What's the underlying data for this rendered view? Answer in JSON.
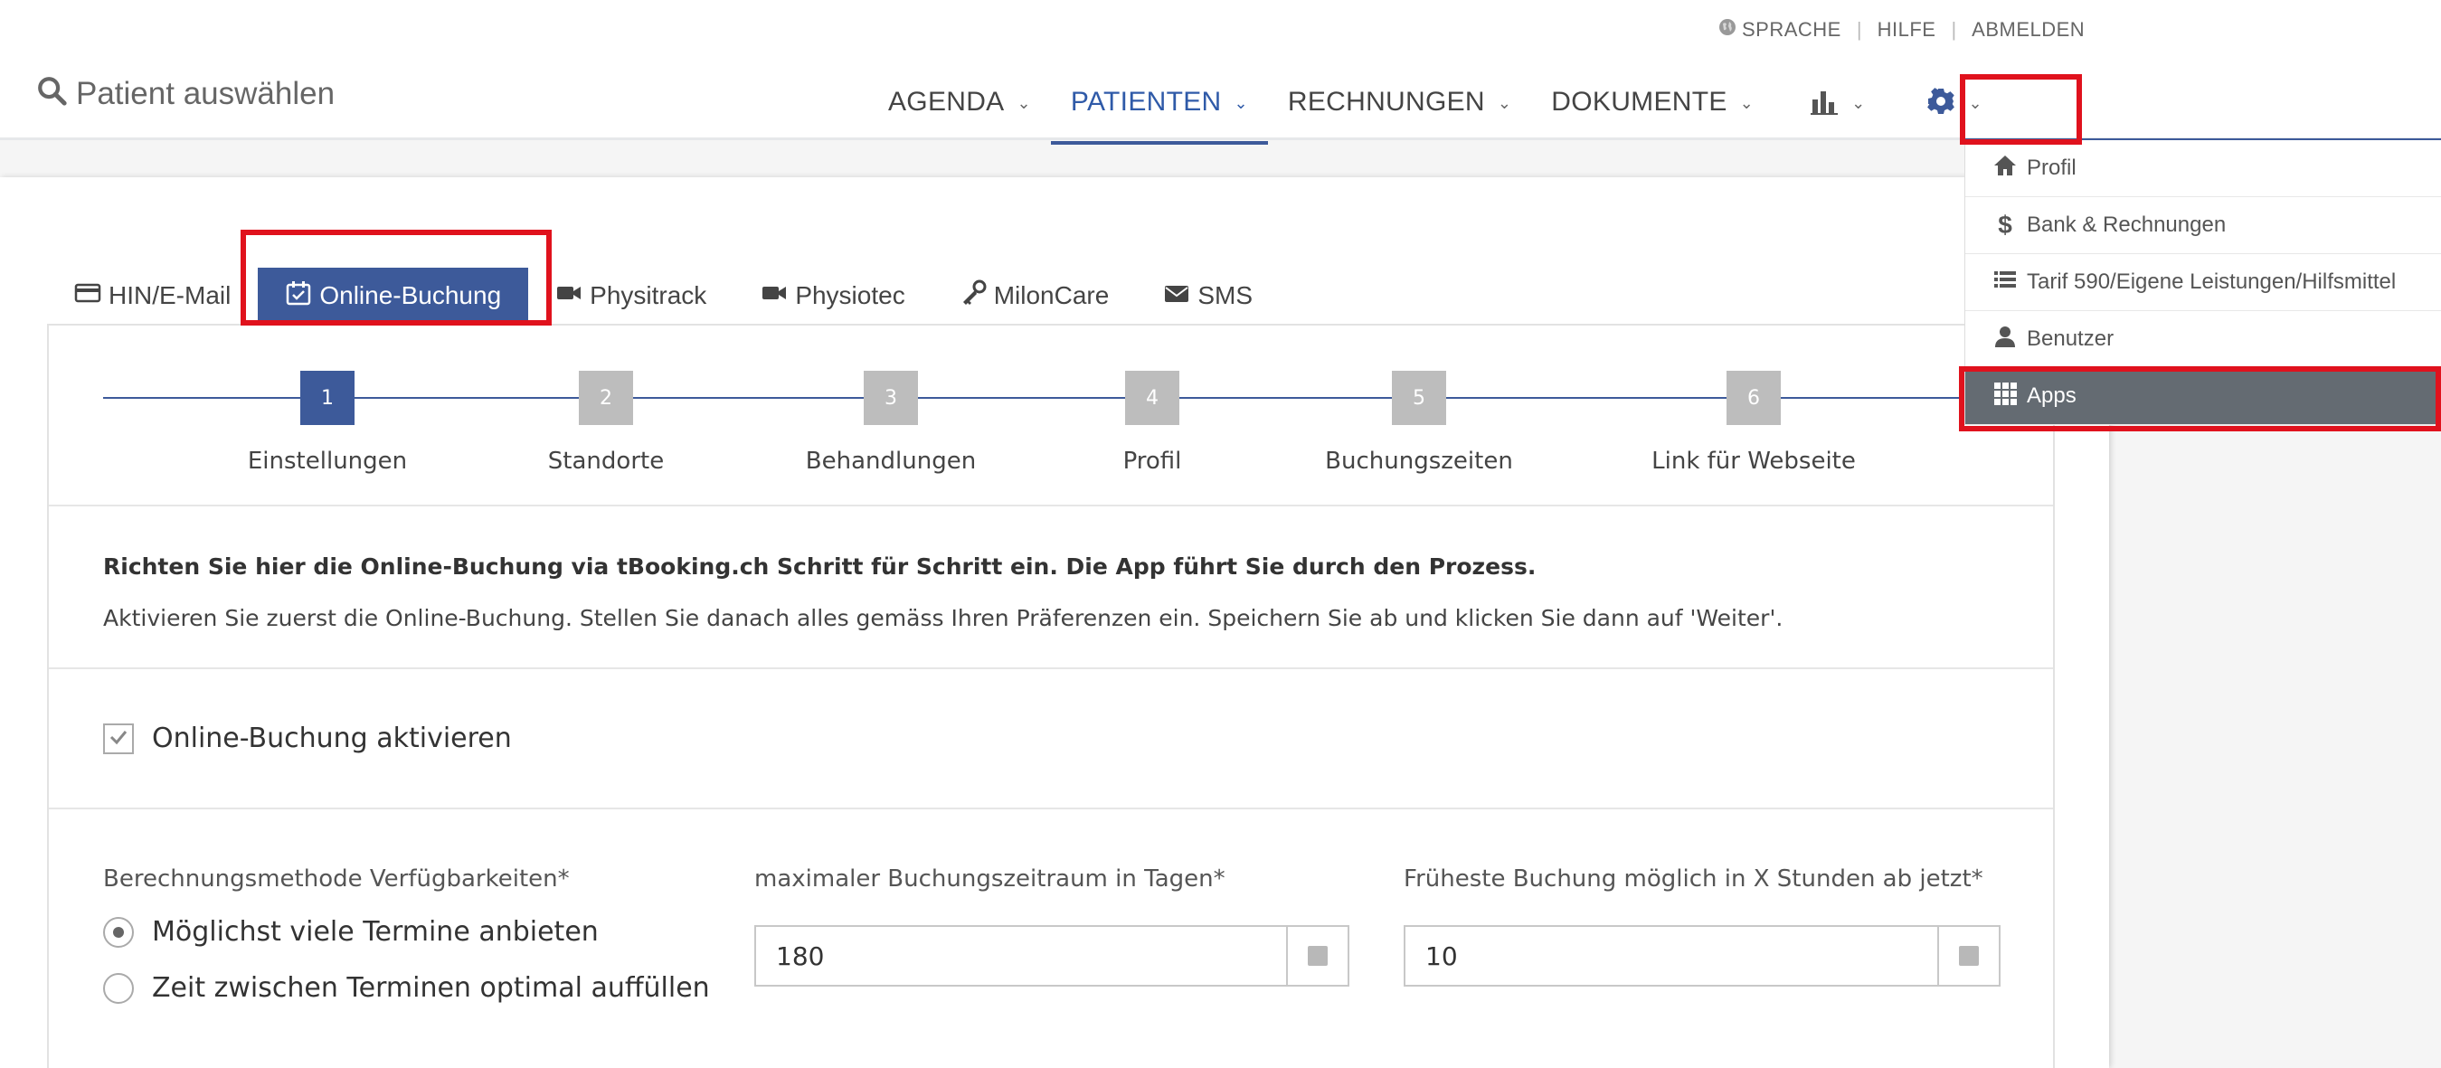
{
  "header": {
    "patient_select": "Patient auswählen",
    "top_links": {
      "language": "SPRACHE",
      "help": "HILFE",
      "logout": "ABMELDEN"
    },
    "nav": [
      {
        "label": "AGENDA"
      },
      {
        "label": "PATIENTEN",
        "active": true
      },
      {
        "label": "RECHNUNGEN"
      },
      {
        "label": "DOKUMENTE"
      }
    ],
    "icons": {
      "stats": "bar-chart-icon",
      "settings": "gear-icon"
    }
  },
  "settings_menu": {
    "items": [
      {
        "label": "Profil",
        "icon": "home-icon"
      },
      {
        "label": "Bank & Rechnungen",
        "icon": "dollar-icon"
      },
      {
        "label": "Tarif 590/Eigene Leistungen/Hilfsmittel",
        "icon": "list-icon"
      },
      {
        "label": "Benutzer",
        "icon": "user-icon"
      },
      {
        "label": "Apps",
        "icon": "grid-icon",
        "active": true
      }
    ]
  },
  "tabs": [
    {
      "label": "HIN/E-Mail",
      "icon": "credit-card-icon"
    },
    {
      "label": "Online-Buchung",
      "icon": "calendar-check-icon",
      "active": true
    },
    {
      "label": "Physitrack",
      "icon": "video-camera-icon"
    },
    {
      "label": "Physiotec",
      "icon": "video-camera-icon"
    },
    {
      "label": "MilonCare",
      "icon": "key-icon"
    },
    {
      "label": "SMS",
      "icon": "envelope-icon"
    }
  ],
  "stepper": {
    "steps": [
      {
        "num": "1",
        "label": "Einstellungen",
        "active": true
      },
      {
        "num": "2",
        "label": "Standorte"
      },
      {
        "num": "3",
        "label": "Behandlungen"
      },
      {
        "num": "4",
        "label": "Profil"
      },
      {
        "num": "5",
        "label": "Buchungszeiten"
      },
      {
        "num": "6",
        "label": "Link für Webseite"
      }
    ]
  },
  "intro": {
    "bold": "Richten Sie hier die Online-Buchung via tBooking.ch Schritt für Schritt ein. Die App führt Sie durch den Prozess.",
    "text": "Aktivieren Sie zuerst die Online-Buchung. Stellen Sie danach alles gemäss Ihren Präferenzen ein. Speichern Sie ab und klicken Sie dann auf 'Weiter'."
  },
  "activate": {
    "label": "Online-Buchung aktivieren",
    "checked": true
  },
  "form": {
    "method_label": "Berechnungsmethode Verfügbarkeiten*",
    "method_options": [
      {
        "label": "Möglichst viele Termine anbieten",
        "selected": true
      },
      {
        "label": "Zeit zwischen Terminen optimal auffüllen",
        "selected": false
      }
    ],
    "max_period_label": "maximaler Buchungszeitraum in Tagen*",
    "max_period_value": "180",
    "earliest_label": "Früheste Buchung möglich in X Stunden ab jetzt*",
    "earliest_value": "10"
  },
  "colors": {
    "accent": "#3d5a9a",
    "highlight": "#e0121d",
    "menu_active": "#646b72"
  }
}
